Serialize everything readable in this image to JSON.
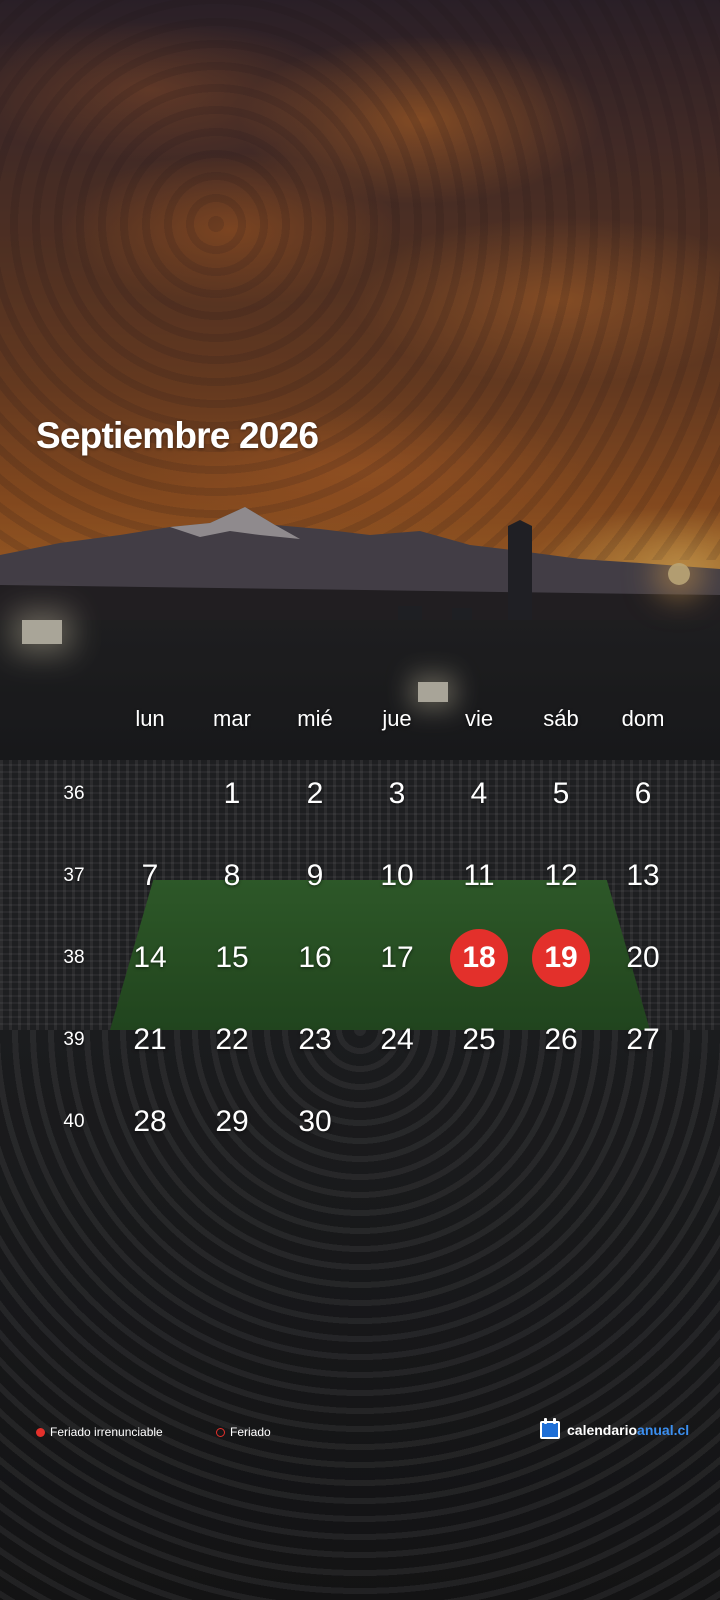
{
  "calendar": {
    "title": "Septiembre 2026",
    "weekdays": [
      "lun",
      "mar",
      "mié",
      "jue",
      "vie",
      "sáb",
      "dom"
    ],
    "weeks": [
      {
        "number": "36",
        "days": [
          "",
          "1",
          "2",
          "3",
          "4",
          "5",
          "6"
        ]
      },
      {
        "number": "37",
        "days": [
          "7",
          "8",
          "9",
          "10",
          "11",
          "12",
          "13"
        ]
      },
      {
        "number": "38",
        "days": [
          "14",
          "15",
          "16",
          "17",
          "18",
          "19",
          "20"
        ]
      },
      {
        "number": "39",
        "days": [
          "21",
          "22",
          "23",
          "24",
          "25",
          "26",
          "27"
        ]
      },
      {
        "number": "40",
        "days": [
          "28",
          "29",
          "30",
          "",
          "",
          "",
          ""
        ]
      }
    ],
    "holidays_irrenunciable": [
      "18",
      "19"
    ],
    "holiday_color": "#e3302b"
  },
  "legend": {
    "irrenunciable_label": "Feriado irrenunciable",
    "feriado_label": "Feriado"
  },
  "brand": {
    "part1": "calendario",
    "part2": "anual.cl",
    "icon": "calendar-icon",
    "accent_color": "#3b8ff0"
  }
}
